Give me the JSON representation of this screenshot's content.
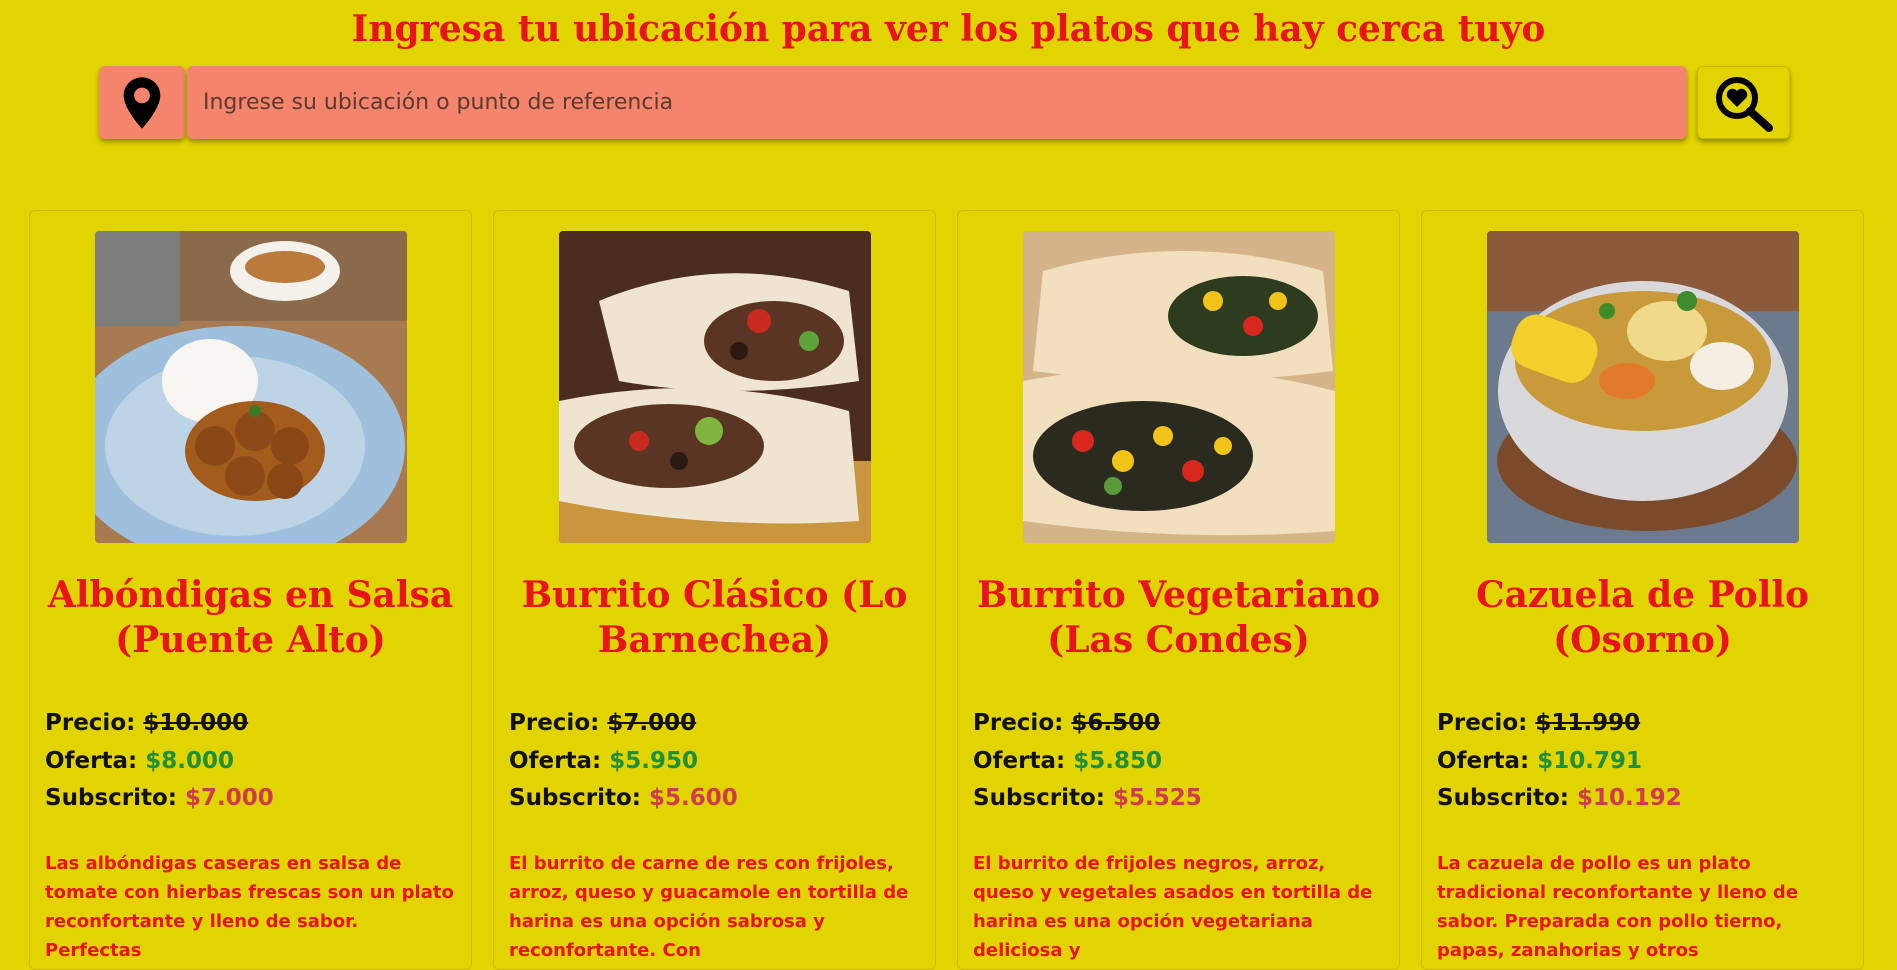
{
  "header": {
    "title": "Ingresa tu ubicación para ver los platos que hay cerca tuyo"
  },
  "search": {
    "location_icon": "map-pin-icon",
    "placeholder": "Ingrese su ubicación o punto de referencia",
    "value": "",
    "search_icon": "heart-magnifier-icon"
  },
  "labels": {
    "price": "Precio:",
    "offer": "Oferta:",
    "subscribed": "Subscrito:"
  },
  "colors": {
    "background": "#e2d400",
    "accent_red": "#e8131b",
    "input_salmon": "#f4846c",
    "offer_green": "#1f8f3a",
    "subscribed_pink": "#d13b4e"
  },
  "cards": [
    {
      "title": "Albóndigas en Salsa (Puente Alto)",
      "image": "meatballs-rice-plate",
      "price": "$10.000",
      "offer": "$8.000",
      "subscribed": "$7.000",
      "description": "Las albóndigas caseras en salsa de tomate con hierbas frescas son un plato reconfortante y lleno de sabor. Perfectas"
    },
    {
      "title": "Burrito Clásico (Lo Barnechea)",
      "image": "beef-burrito",
      "price": "$7.000",
      "offer": "$5.950",
      "subscribed": "$5.600",
      "description": "El burrito de carne de res con frijoles, arroz, queso y guacamole en tortilla de harina es una opción sabrosa y reconfortante. Con"
    },
    {
      "title": "Burrito Vegetariano (Las Condes)",
      "image": "veggie-burrito",
      "price": "$6.500",
      "offer": "$5.850",
      "subscribed": "$5.525",
      "description": "El burrito de frijoles negros, arroz, queso y vegetales asados en tortilla de harina es una opción vegetariana deliciosa y"
    },
    {
      "title": "Cazuela de Pollo (Osorno)",
      "image": "chicken-cazuela-bowl",
      "price": "$11.990",
      "offer": "$10.791",
      "subscribed": "$10.192",
      "description": "La cazuela de pollo es un plato tradicional reconfortante y lleno de sabor. Preparada con pollo tierno, papas, zanahorias y otros"
    }
  ]
}
